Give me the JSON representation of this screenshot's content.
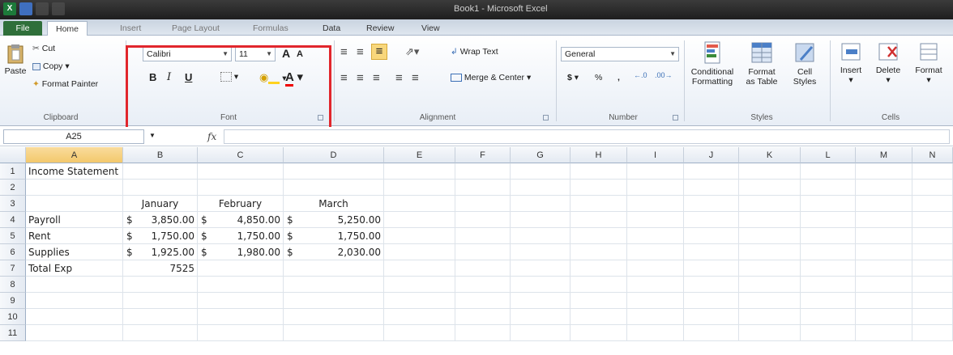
{
  "window": {
    "title": "Book1 - Microsoft Excel"
  },
  "tabs": [
    "File",
    "Home",
    "Insert",
    "Page Layout",
    "Formulas",
    "Data",
    "Review",
    "View"
  ],
  "clipboard": {
    "paste": "Paste",
    "cut": "Cut",
    "copy": "Copy",
    "format_painter": "Format Painter",
    "label": "Clipboard"
  },
  "font": {
    "name": "Calibri",
    "size": "11",
    "bold": "B",
    "italic": "I",
    "underline": "U",
    "grow": "A",
    "shrink": "A",
    "color_icon": "A",
    "label": "Font"
  },
  "alignment": {
    "wrap": "Wrap Text",
    "merge": "Merge & Center",
    "label": "Alignment"
  },
  "number": {
    "format": "General",
    "currency": "$",
    "percent": "%",
    "comma": ",",
    "label": "Number"
  },
  "styles": {
    "conditional": "Conditional",
    "conditional2": "Formatting",
    "format_table": "Format",
    "format_table2": "as Table",
    "cell_styles": "Cell",
    "cell_styles2": "Styles",
    "label": "Styles"
  },
  "cells_group": {
    "insert": "Insert",
    "delete": "Delete",
    "format": "Format",
    "label": "Cells"
  },
  "formula_bar": {
    "name_box": "A25",
    "fx": "fx",
    "formula": ""
  },
  "grid": {
    "columns": [
      "A",
      "B",
      "C",
      "D",
      "E",
      "F",
      "G",
      "H",
      "I",
      "J",
      "K",
      "L",
      "M",
      "N"
    ],
    "rows": [
      "1",
      "2",
      "3",
      "4",
      "5",
      "6",
      "7",
      "8",
      "9",
      "10",
      "11"
    ],
    "title": "Income Statement",
    "months": [
      "January",
      "February",
      "March"
    ],
    "items": [
      {
        "label": "Payroll",
        "b": "3,850.00",
        "c": "4,850.00",
        "d": "5,250.00"
      },
      {
        "label": "Rent",
        "b": "1,750.00",
        "c": "1,750.00",
        "d": "1,750.00"
      },
      {
        "label": "Supplies",
        "b": "1,925.00",
        "c": "1,980.00",
        "d": "2,030.00"
      }
    ],
    "currency_symbol": "$",
    "total_label": "Total Exp",
    "total_value": "7525"
  },
  "colors": {
    "highlight": "#e1262c",
    "file_tab": "#2f6f3a"
  }
}
